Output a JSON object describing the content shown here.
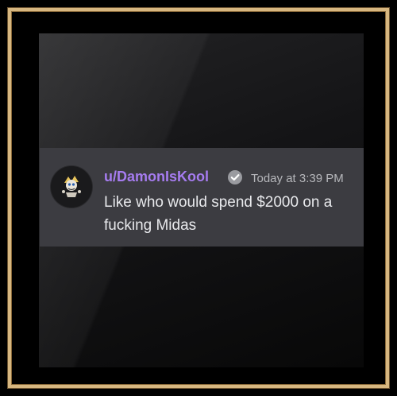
{
  "message": {
    "username": "u/DamonIsKool",
    "badge_icon": "verified-check-icon",
    "timestamp": "Today at 3:39 PM",
    "text": "Like who would spend $2000 on a fucking Midas",
    "username_color": "#a67cf0",
    "avatar_icon": "avatar-mascot-icon"
  },
  "colors": {
    "frame": "#d7b780",
    "message_background": "#3c3c41",
    "text": "#e8e9ec",
    "timestamp": "#b6b7bb"
  }
}
